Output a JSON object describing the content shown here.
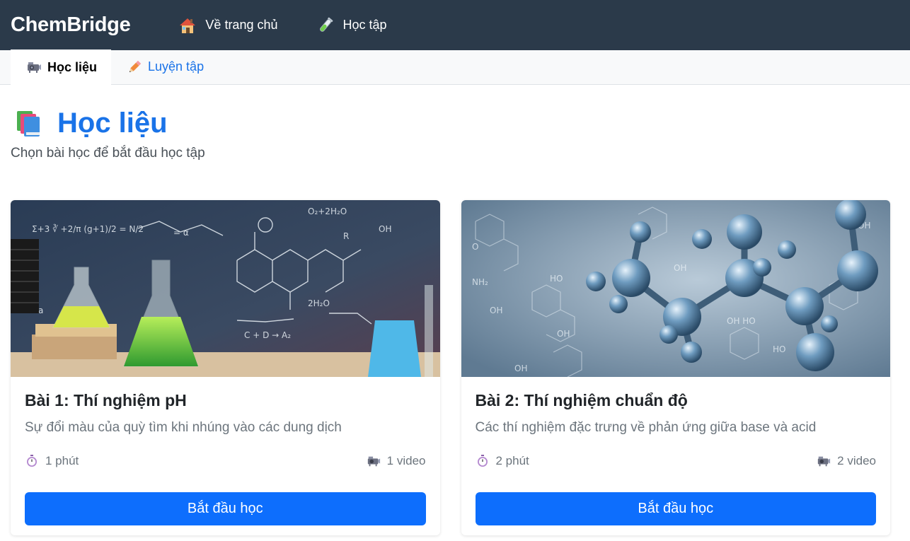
{
  "app": {
    "brand": "ChemBridge"
  },
  "nav": {
    "home_label": "Về trang chủ",
    "study_label": "Học tập"
  },
  "tabs": [
    {
      "label": "Học liệu",
      "active": true,
      "icon": "projector-icon"
    },
    {
      "label": "Luyện tập",
      "active": false,
      "icon": "pencil-icon"
    }
  ],
  "page": {
    "title": "Học liệu",
    "subtitle": "Chọn bài học để bắt đầu học tập"
  },
  "lessons": [
    {
      "title": "Bài 1: Thí nghiệm pH",
      "description": "Sự đổi màu của quỳ tìm khi nhúng vào các dung dịch",
      "duration": "1 phút",
      "videos": "1 video",
      "button": "Bắt đầu học"
    },
    {
      "title": "Bài 2: Thí nghiệm chuẩn độ",
      "description": "Các thí nghiệm đặc trưng về phản ứng giữa base và acid",
      "duration": "2 phút",
      "videos": "2 video",
      "button": "Bắt đầu học"
    }
  ],
  "colors": {
    "navbar": "#2b3a4a",
    "accent": "#1a73e8",
    "button": "#0d6efd"
  }
}
